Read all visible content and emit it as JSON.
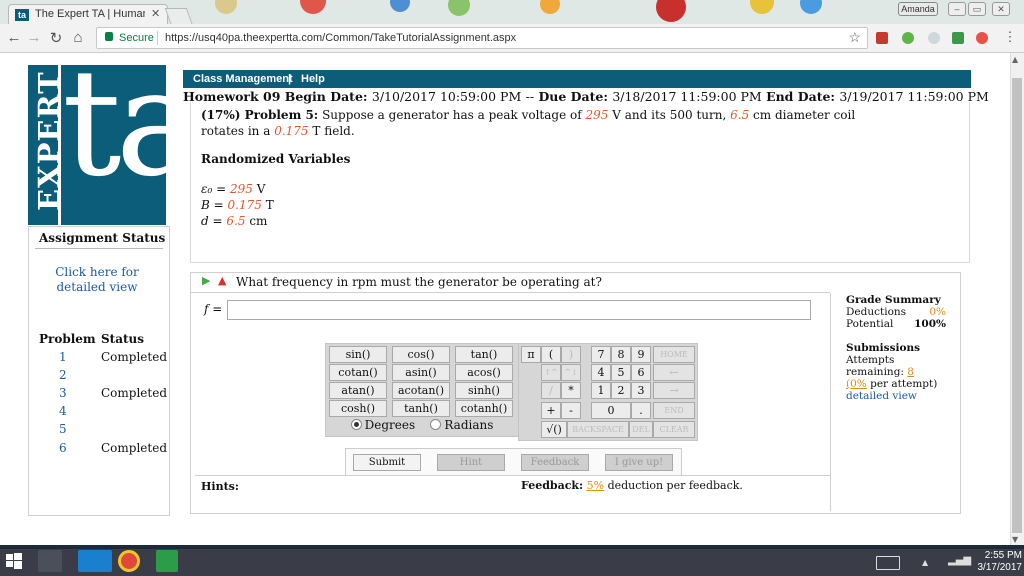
{
  "browser": {
    "tab_title": "The Expert TA | Human-",
    "tab_icon": "ta",
    "profile": "Amanda",
    "secure_label": "Secure",
    "url": "https://usq40pa.theexpertta.com/Common/TakeTutorialAssignment.aspx",
    "accent": "#0b5d7a"
  },
  "logo": {
    "expert": "EXPERT",
    "ta": "ta"
  },
  "menu": {
    "class_management": "Class Management",
    "sep": "|",
    "help": "Help"
  },
  "homework": {
    "title": "Homework 09",
    "begin_label": "Begin Date:",
    "begin_date": "3/10/2017 10:59:00 PM",
    "due_prefix": "--",
    "due_label": "Due Date:",
    "due_date": "3/18/2017 11:59:00 PM",
    "end_label": "End Date:",
    "end_date": "3/19/2017 11:59:00 PM"
  },
  "problem": {
    "weight": "(17%) Problem 5:",
    "text_1": "Suppose a generator has a peak voltage of",
    "voltage": "295",
    "text_2": "V and its 500 turn,",
    "diameter": "6.5",
    "text_3": "cm diameter coil rotates in a",
    "field": "0.175",
    "text_4": "T field."
  },
  "randomized": {
    "heading": "Randomized Variables",
    "vars": [
      {
        "sym": "ε₀ =",
        "value": "295",
        "unit": "V"
      },
      {
        "sym": "B =",
        "value": "0.175",
        "unit": "T"
      },
      {
        "sym": "d =",
        "value": "6.5",
        "unit": "cm"
      }
    ]
  },
  "assignment_status": {
    "heading": "Assignment Status",
    "detail_link": "Click here for detailed view",
    "col_problem": "Problem",
    "col_status": "Status",
    "rows": [
      {
        "num": "1",
        "status": "Completed"
      },
      {
        "num": "2",
        "status": ""
      },
      {
        "num": "3",
        "status": "Completed"
      },
      {
        "num": "4",
        "status": ""
      },
      {
        "num": "5",
        "status": ""
      },
      {
        "num": "6",
        "status": "Completed"
      }
    ]
  },
  "question": {
    "text": "What frequency in rpm must the generator be operating at?",
    "answer_label": "f =",
    "answer_value": ""
  },
  "keypad": {
    "functions": [
      "sin()",
      "cos()",
      "tan()",
      "cotan()",
      "asin()",
      "acos()",
      "atan()",
      "acotan()",
      "sinh()",
      "cosh()",
      "tanh()",
      "cotanh()"
    ],
    "degrees": "Degrees",
    "radians": "Radians",
    "pi": "π",
    "lparen": "(",
    "rparen": ")",
    "seven": "7",
    "eight": "8",
    "nine": "9",
    "four": "4",
    "five": "5",
    "six": "6",
    "one": "1",
    "two": "2",
    "three": "3",
    "zero": "0",
    "dot": ".",
    "up": "↑^",
    "up2": "^↓",
    "divide": "/",
    "times": "*",
    "plus": "+",
    "minus": "-",
    "sqrt": "√()",
    "home": "HOME",
    "back_arrow": "←",
    "fwd_arrow": "→",
    "end": "END",
    "backspace": "BACKSPACE",
    "del": "DEL",
    "clear": "CLEAR"
  },
  "grade_summary": {
    "title": "Grade Summary",
    "deductions_label": "Deductions",
    "deductions_value": "0%",
    "potential_label": "Potential",
    "potential_value": "100%",
    "submissions_title": "Submissions",
    "attempts_label": "Attempts remaining:",
    "attempts_value": "8",
    "per_attempt_pct": "(0%",
    "per_attempt_text": "per attempt)",
    "detailed_view": "detailed view"
  },
  "actions": {
    "submit": "Submit",
    "hint": "Hint",
    "feedback": "Feedback",
    "give_up": "I give up!"
  },
  "hints_label": "Hints:",
  "feedback_info": {
    "label": "Feedback:",
    "pct": "5%",
    "text": "deduction per feedback."
  },
  "taskbar": {
    "time": "2:55 PM",
    "date": "3/17/2017"
  }
}
